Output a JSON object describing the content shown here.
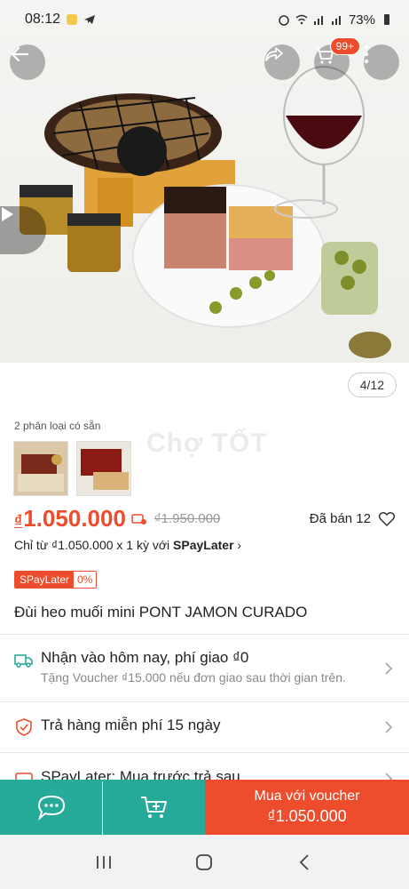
{
  "status_bar": {
    "time": "08:12",
    "battery": "73%"
  },
  "hero": {
    "image_counter": "4/12",
    "cart_badge": "99+"
  },
  "variants": {
    "label": "2 phân loại có sẵn",
    "watermark": "Chợ TỐT"
  },
  "price": {
    "currency": "₫",
    "current": "1.050.000",
    "original": "₫1.950.000",
    "sold": "Đã bán 12"
  },
  "installment": {
    "prefix": "Chỉ từ ₫1.050.000 x 1 kỳ với ",
    "brand": "SPayLater",
    "arrow": "›"
  },
  "spl_tag": {
    "name": "SPayLater",
    "rate": "0%"
  },
  "product": {
    "title": "Đùi heo muối mini PONT JAMON CURADO"
  },
  "shipping": {
    "main": "Nhận vào hôm nay, phí giao ₫0",
    "sub": "Tặng Voucher ₫15.000 nếu đơn giao sau thời gian trên."
  },
  "returns": {
    "main": "Trả hàng miễn phí 15 ngày"
  },
  "spaylater_row": {
    "main": "SPayLater: Mua trước trả sau"
  },
  "actions": {
    "buy_line1": "Mua với voucher",
    "buy_line2": "₫1.050.000"
  },
  "colors": {
    "brand": "#ee4d2d",
    "teal": "#26aa99"
  }
}
